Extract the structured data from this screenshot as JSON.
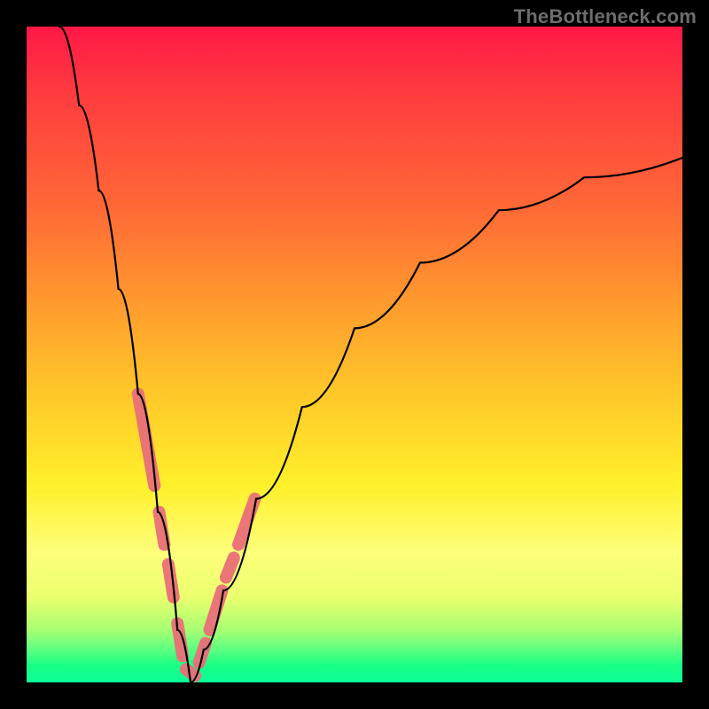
{
  "watermark": {
    "text": "TheBottleneck.com"
  },
  "chart_data": {
    "type": "line",
    "title": "",
    "xlabel": "",
    "ylabel": "",
    "ylim": [
      0,
      100
    ],
    "xlim": [
      0,
      100
    ],
    "minimum_x": 25,
    "description": "V-shaped bottleneck curve with minimum near x≈25; y≈100 at x=0, y≈0 at x≈25, y≈80 at x=100",
    "curve_points": [
      {
        "x": 5,
        "y": 100
      },
      {
        "x": 8,
        "y": 88
      },
      {
        "x": 11,
        "y": 75
      },
      {
        "x": 14,
        "y": 60
      },
      {
        "x": 17,
        "y": 44
      },
      {
        "x": 20,
        "y": 26
      },
      {
        "x": 23,
        "y": 8
      },
      {
        "x": 25,
        "y": 0
      },
      {
        "x": 27,
        "y": 5
      },
      {
        "x": 30,
        "y": 14
      },
      {
        "x": 35,
        "y": 28
      },
      {
        "x": 42,
        "y": 42
      },
      {
        "x": 50,
        "y": 54
      },
      {
        "x": 60,
        "y": 64
      },
      {
        "x": 72,
        "y": 72
      },
      {
        "x": 85,
        "y": 77
      },
      {
        "x": 100,
        "y": 80
      }
    ],
    "marker_segments": [
      {
        "x0": 17.0,
        "y0": 44,
        "x1": 19.5,
        "y1": 30
      },
      {
        "x0": 20.2,
        "y0": 26,
        "x1": 21.0,
        "y1": 21
      },
      {
        "x0": 21.6,
        "y0": 18,
        "x1": 22.4,
        "y1": 13
      },
      {
        "x0": 23.0,
        "y0": 9,
        "x1": 23.8,
        "y1": 4
      },
      {
        "x0": 24.3,
        "y0": 2,
        "x1": 25.7,
        "y1": 1
      },
      {
        "x0": 26.3,
        "y0": 3,
        "x1": 27.3,
        "y1": 6
      },
      {
        "x0": 27.9,
        "y0": 8,
        "x1": 29.8,
        "y1": 14
      },
      {
        "x0": 30.4,
        "y0": 16,
        "x1": 31.6,
        "y1": 19
      },
      {
        "x0": 32.3,
        "y0": 21,
        "x1": 34.8,
        "y1": 28
      }
    ],
    "colors": {
      "curve": "#000000",
      "markers": "#e96f78",
      "gradient_top": "#ff1846",
      "gradient_bottom": "#0bff97"
    }
  }
}
